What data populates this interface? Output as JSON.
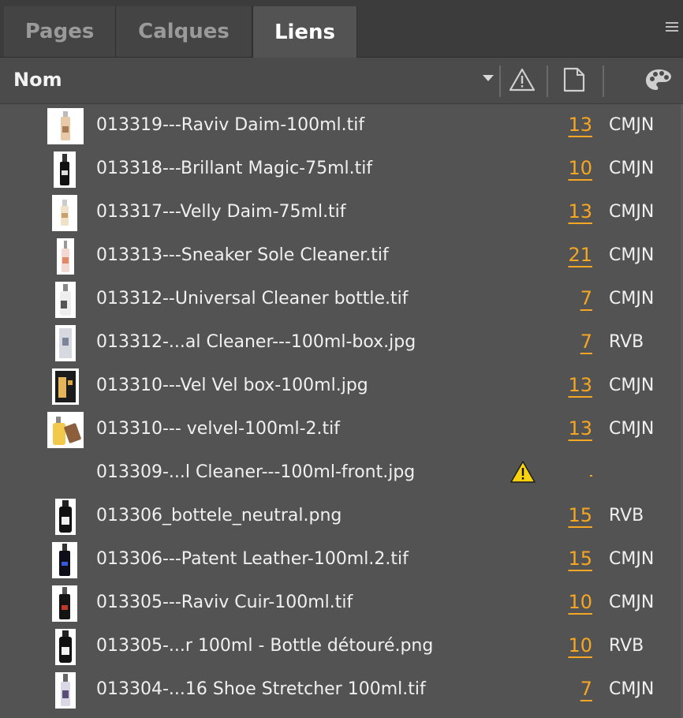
{
  "tabs": [
    {
      "label": "Pages"
    },
    {
      "label": "Calques"
    },
    {
      "label": "Liens"
    }
  ],
  "header": {
    "name_label": "Nom",
    "icons": [
      "warning-column-icon",
      "page-column-icon",
      "color-palette-icon"
    ]
  },
  "colors": {
    "accent": "#f5a623",
    "panel_bg": "#535353",
    "tabbar_bg": "#3c3c3c"
  },
  "links": [
    {
      "name": "013319---Raviv Daim-100ml.tif",
      "page": "13",
      "color": "CMJN"
    },
    {
      "name": "013318---Brillant Magic-75ml.tif",
      "page": "10",
      "color": "CMJN"
    },
    {
      "name": "013317---Velly Daim-75ml.tif",
      "page": "13",
      "color": "CMJN"
    },
    {
      "name": "013313---Sneaker Sole Cleaner.tif",
      "page": "21",
      "color": "CMJN"
    },
    {
      "name": "013312--Universal Cleaner bottle.tif",
      "page": "7",
      "color": "CMJN"
    },
    {
      "name": "013312-...al Cleaner---100ml-box.jpg",
      "page": "7",
      "color": "RVB"
    },
    {
      "name": "013310---Vel Vel box-100ml.jpg",
      "page": "13",
      "color": "CMJN"
    },
    {
      "name": "013310--- velvel-100ml-2.tif",
      "page": "13",
      "color": "CMJN"
    },
    {
      "name": "013309-...l Cleaner---100ml-front.jpg",
      "page": "",
      "color": "",
      "status": "missing-warning"
    },
    {
      "name": "013306_bottele_neutral.png",
      "page": "15",
      "color": "RVB"
    },
    {
      "name": "013306---Patent Leather-100ml.2.tif",
      "page": "15",
      "color": "CMJN"
    },
    {
      "name": "013305---Raviv Cuir-100ml.tif",
      "page": "10",
      "color": "CMJN"
    },
    {
      "name": "013305-...r 100ml - Bottle détouré.png",
      "page": "10",
      "color": "RVB"
    },
    {
      "name": "013304-...16 Shoe Stretcher 100ml.tif",
      "page": "7",
      "color": "CMJN"
    }
  ]
}
